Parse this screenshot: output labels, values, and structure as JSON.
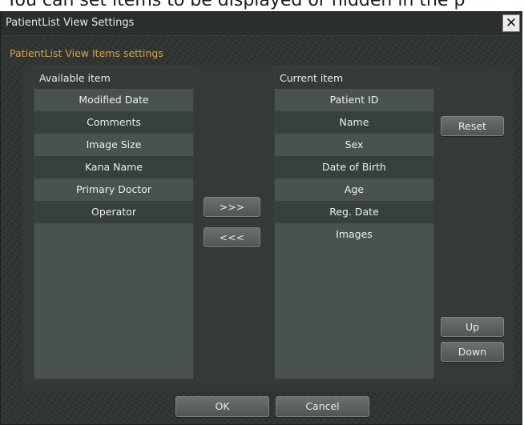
{
  "background_caption": "You can set items to be displayed or hidden in the p",
  "window": {
    "title": "PatientList View Settings",
    "close_glyph": "✕"
  },
  "group": {
    "title": "PatientList View Items settings"
  },
  "available": {
    "header": "Available item",
    "items": [
      "Modified Date",
      "Comments",
      "Image Size",
      "Kana Name",
      "Primary Doctor",
      "Operator"
    ]
  },
  "current": {
    "header": "Current item",
    "items": [
      "Patient ID",
      "Name",
      "Sex",
      "Date of Birth",
      "Age",
      "Reg. Date",
      "Images"
    ]
  },
  "buttons": {
    "add": ">>>",
    "remove": "<<<",
    "reset": "Reset",
    "up": "Up",
    "down": "Down",
    "ok": "OK",
    "cancel": "Cancel"
  },
  "colors": {
    "accent": "#d9a541",
    "dialog_bg": "#2f3332",
    "list_bg": "#4a5250"
  }
}
